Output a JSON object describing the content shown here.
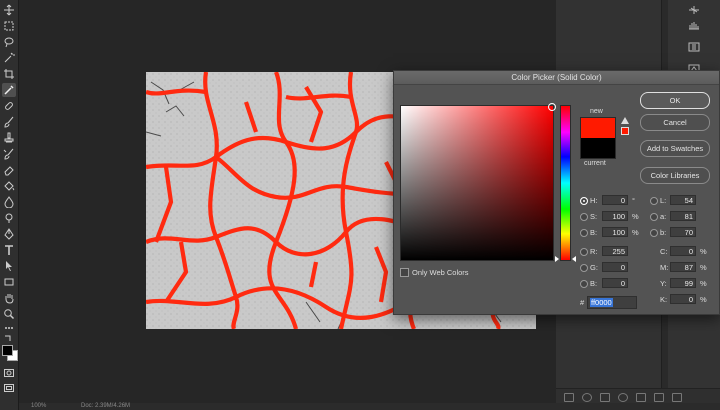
{
  "dialog": {
    "title": "Color Picker (Solid Color)",
    "label_new": "new",
    "label_current": "current",
    "new_color": "#ff1a00",
    "current_color": "#000000",
    "buttons": {
      "ok": "OK",
      "cancel": "Cancel",
      "add_swatches": "Add to Swatches",
      "libraries": "Color Libraries"
    },
    "web_colors_label": "Only Web Colors",
    "hsb": [
      {
        "label": "H:",
        "value": "0",
        "unit": "°",
        "selected": true
      },
      {
        "label": "S:",
        "value": "100",
        "unit": "%",
        "selected": false
      },
      {
        "label": "B:",
        "value": "100",
        "unit": "%",
        "selected": false
      }
    ],
    "rgb": [
      {
        "label": "R:",
        "value": "255"
      },
      {
        "label": "G:",
        "value": "0"
      },
      {
        "label": "B:",
        "value": "0"
      }
    ],
    "lab": [
      {
        "label": "L:",
        "value": "54"
      },
      {
        "label": "a:",
        "value": "81"
      },
      {
        "label": "b:",
        "value": "70"
      }
    ],
    "cmyk": [
      {
        "label": "C:",
        "value": "0",
        "unit": "%"
      },
      {
        "label": "M:",
        "value": "87",
        "unit": "%"
      },
      {
        "label": "Y:",
        "value": "99",
        "unit": "%"
      },
      {
        "label": "K:",
        "value": "0",
        "unit": "%"
      }
    ],
    "hex_label": "#",
    "hex_value": "ff0000"
  },
  "status": {
    "zoom": "100%",
    "doc": "Doc: 2.39M/4.26M"
  },
  "icons": {
    "toolbar": [
      "move-icon",
      "marquee-icon",
      "lasso-icon",
      "magic-wand-icon",
      "crop-icon",
      "eyedropper-icon",
      "healing-icon",
      "brush-icon",
      "stamp-icon",
      "history-brush-icon",
      "eraser-icon",
      "bucket-icon",
      "blur-icon",
      "dodge-icon",
      "pen-icon",
      "type-icon",
      "path-select-icon",
      "shape-icon",
      "hand-icon",
      "zoom-icon",
      "more-icon"
    ]
  }
}
